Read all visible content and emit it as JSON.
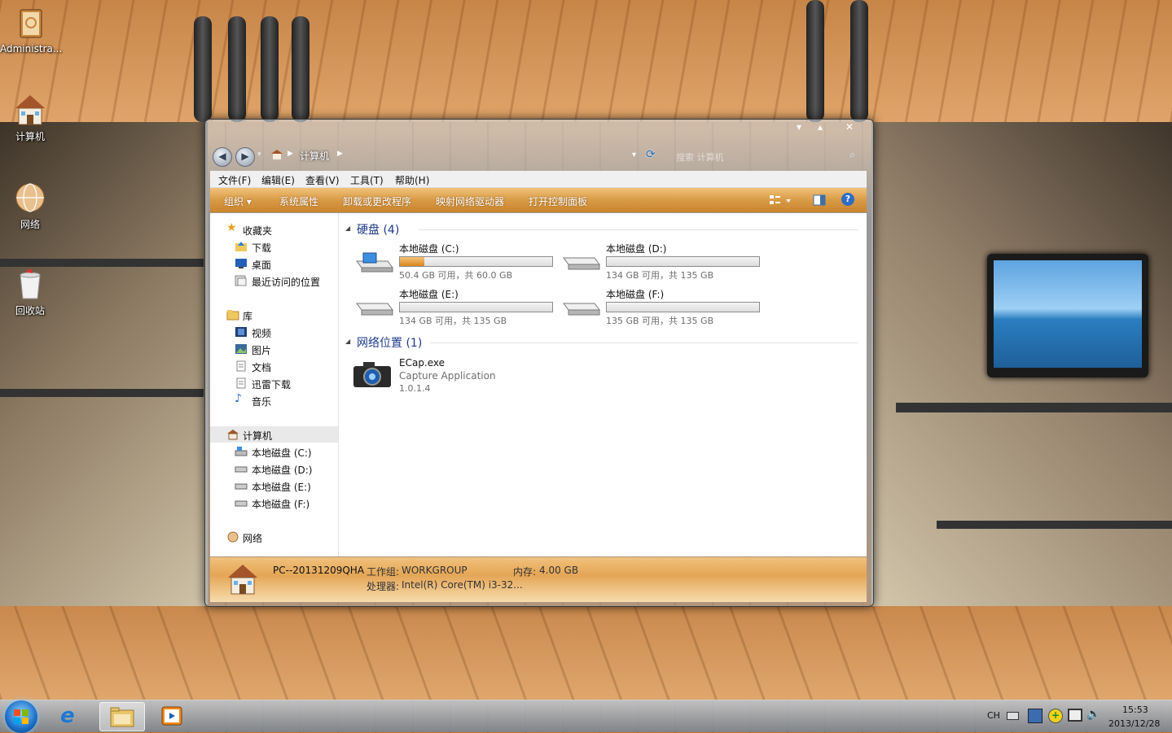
{
  "desktop": {
    "icons": [
      {
        "label": "Administra..."
      },
      {
        "label": "计算机"
      },
      {
        "label": "网络"
      },
      {
        "label": "回收站"
      }
    ]
  },
  "window": {
    "address": {
      "root": "计算机"
    },
    "search_placeholder": "搜索 计算机",
    "menu": [
      "文件(F)",
      "编辑(E)",
      "查看(V)",
      "工具(T)",
      "帮助(H)"
    ],
    "toolbar": [
      "组织 ▾",
      "系统属性",
      "卸载或更改程序",
      "映射网络驱动器",
      "打开控制面板"
    ],
    "nav": {
      "favorites": {
        "title": "收藏夹",
        "items": [
          "下载",
          "桌面",
          "最近访问的位置"
        ]
      },
      "libraries": {
        "title": "库",
        "items": [
          "视频",
          "图片",
          "文档",
          "迅雷下载",
          "音乐"
        ]
      },
      "computer": {
        "title": "计算机",
        "items": [
          "本地磁盘 (C:)",
          "本地磁盘 (D:)",
          "本地磁盘 (E:)",
          "本地磁盘 (F:)"
        ]
      },
      "network": {
        "title": "网络"
      }
    },
    "groups": {
      "disks": {
        "title": "硬盘 (4)"
      },
      "network": {
        "title": "网络位置 (1)"
      }
    },
    "drives": [
      {
        "name": "本地磁盘 (C:)",
        "info": "50.4 GB 可用，共 60.0 GB",
        "used_fraction": 0.16
      },
      {
        "name": "本地磁盘 (D:)",
        "info": "134 GB 可用，共 135 GB",
        "used_fraction": 0.0
      },
      {
        "name": "本地磁盘 (E:)",
        "info": "134 GB 可用，共 135 GB",
        "used_fraction": 0.0
      },
      {
        "name": "本地磁盘 (F:)",
        "info": "135 GB 可用，共 135 GB",
        "used_fraction": 0.0
      }
    ],
    "network_item": {
      "name": "ECap.exe",
      "desc": "Capture Application",
      "version": "1.0.1.4"
    },
    "status": {
      "pc_name": "PC--20131209QHA",
      "workgroup_label": "工作组:",
      "workgroup": "WORKGROUP",
      "memory_label": "内存:",
      "memory": "4.00 GB",
      "cpu_label": "处理器:",
      "cpu": "Intel(R) Core(TM) i3-32..."
    }
  },
  "taskbar": {
    "lang": "CH",
    "time": "15:53",
    "date": "2013/12/28"
  }
}
